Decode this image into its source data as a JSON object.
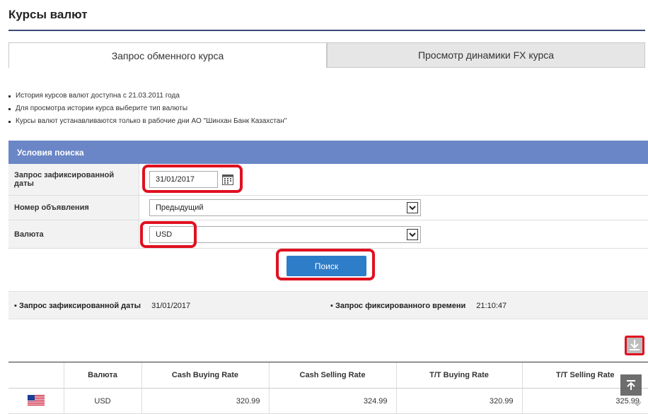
{
  "page": {
    "title": "Курсы валют"
  },
  "tabs": [
    {
      "label": "Запрос обменного курса",
      "active": true
    },
    {
      "label": "Просмотр динамики FX курса",
      "active": false
    }
  ],
  "notes": [
    "История курсов валют доступна с 21.03.2011 года",
    "Для просмотра истории курса выберите тип валюты",
    "Курсы валют устанавливаются только в рабочие дни АО \"Шинхан Банк Казахстан\""
  ],
  "search": {
    "header": "Условия поиска",
    "date_label": "Запрос зафиксированной даты",
    "date_value": "31/01/2017",
    "notice_label": "Номер объявления",
    "notice_value": "Предыдущий",
    "currency_label": "Валюта",
    "currency_value": "USD",
    "button_label": "Поиск"
  },
  "info": {
    "date_label": "Запрос зафиксированной даты",
    "date_value": "31/01/2017",
    "time_label": "Запрос фиксированного времени",
    "time_value": "21:10:47"
  },
  "table": {
    "headers": [
      "",
      "Валюта",
      "Cash Buying Rate",
      "Cash Selling Rate",
      "T/T Buying Rate",
      "T/T Selling Rate"
    ],
    "rows": [
      {
        "flag": "us-flag-icon",
        "currency": "USD",
        "cash_buying": "320.99",
        "cash_selling": "324.99",
        "tt_buying": "320.99",
        "tt_selling": "325.99"
      }
    ]
  },
  "colors": {
    "header_blue": "#6b86c6",
    "button_blue": "#2e7dc9",
    "highlight_red": "#e01020"
  }
}
